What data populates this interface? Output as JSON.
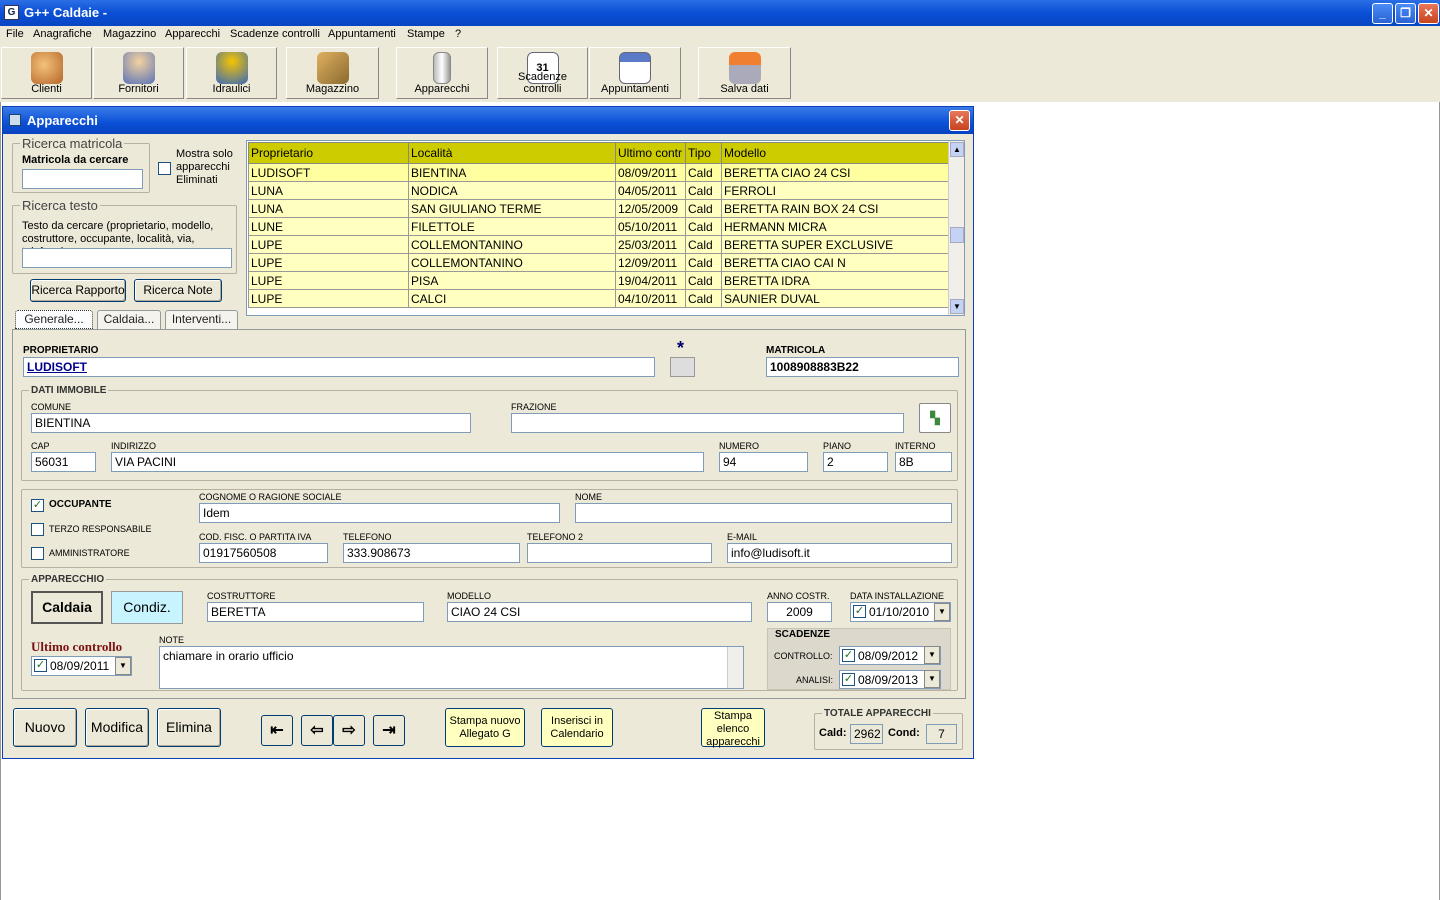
{
  "app": {
    "title": "G++ Caldaie -"
  },
  "menu": [
    "File",
    "Anagrafiche",
    "Magazzino",
    "Apparecchi",
    "Scadenze controlli",
    "Appuntamenti",
    "Stampe",
    "?"
  ],
  "toolbar": [
    "Clienti",
    "Fornitori",
    "Idraulici",
    "Magazzino",
    "Apparecchi",
    "Scadenze controlli",
    "Appuntamenti",
    "Salva dati"
  ],
  "window": {
    "title": "Apparecchi"
  },
  "search": {
    "matricola_legend": "Ricerca matricola",
    "matricola_label": "Matricola da cercare",
    "matricola_value": "",
    "show_deleted": "Mostra solo apparecchi Eliminati",
    "text_legend": "Ricerca testo",
    "text_label": "Testo da cercare (proprietario, modello, costruttore, occupante, località, via, telefono)",
    "text_value": "",
    "btn_rapporto": "Ricerca Rapporto",
    "btn_note": "Ricerca Note"
  },
  "grid": {
    "columns": [
      "Proprietario",
      "Località",
      "Ultimo contr",
      "Tipo",
      "Modello"
    ],
    "rows": [
      [
        "LUDISOFT",
        "BIENTINA",
        "08/09/2011",
        "Cald",
        "BERETTA CIAO 24 CSI"
      ],
      [
        "LUNA",
        "NODICA",
        "04/05/2011",
        "Cald",
        "FERROLI"
      ],
      [
        "LUNA",
        "SAN GIULIANO TERME",
        "12/05/2009",
        "Cald",
        "BERETTA RAIN BOX 24 CSI"
      ],
      [
        "LUNE",
        "FILETTOLE",
        "05/10/2011",
        "Cald",
        "HERMANN MICRA"
      ],
      [
        "LUPE",
        "COLLEMONTANINO",
        "25/03/2011",
        "Cald",
        "BERETTA SUPER EXCLUSIVE"
      ],
      [
        "LUPE",
        "COLLEMONTANINO",
        "12/09/2011",
        "Cald",
        "BERETTA CIAO CAI N"
      ],
      [
        "LUPE",
        "PISA",
        "19/04/2011",
        "Cald",
        "BERETTA IDRA"
      ],
      [
        "LUPE",
        "CALCI",
        "04/10/2011",
        "Cald",
        "SAUNIER DUVAL"
      ]
    ]
  },
  "tabs": [
    "Generale...",
    "Caldaia...",
    "Interventi..."
  ],
  "form": {
    "proprietario_label": "PROPRIETARIO",
    "proprietario": "LUDISOFT",
    "asterisk": "*",
    "matricola_label": "MATRICOLA",
    "matricola": "1008908883B22",
    "immobile_legend": "DATI IMMOBILE",
    "comune_label": "COMUNE",
    "comune": "BIENTINA",
    "frazione_label": "FRAZIONE",
    "frazione": "",
    "cap_label": "CAP",
    "cap": "56031",
    "indirizzo_label": "INDIRIZZO",
    "indirizzo": "VIA PACINI",
    "numero_label": "NUMERO",
    "numero": "94",
    "piano_label": "PIANO",
    "piano": "2",
    "interno_label": "INTERNO",
    "interno": "8B",
    "occupante": "OCCUPANTE",
    "terzo": "TERZO RESPONSABILE",
    "amministratore": "AMMINISTRATORE",
    "cognome_label": "COGNOME O RAGIONE SOCIALE",
    "cognome": "Idem",
    "nome_label": "NOME",
    "nome": "",
    "codfisc_label": "COD. FISC. O PARTITA IVA",
    "codfisc": "01917560508",
    "tel_label": "TELEFONO",
    "tel": "333.908673",
    "tel2_label": "TELEFONO 2",
    "tel2": "",
    "email_label": "E-MAIL",
    "email": "info@ludisoft.it",
    "apparecchio_legend": "APPARECCHIO",
    "caldaia_btn": "Caldaia",
    "condiz_btn": "Condiz.",
    "costruttore_label": "COSTRUTTORE",
    "costruttore": "BERETTA",
    "modello_label": "MODELLO",
    "modello": "CIAO 24 CSI",
    "anno_label": "ANNO COSTR.",
    "anno": "2009",
    "datainst_label": "DATA INSTALLAZIONE",
    "datainst": "01/10/2010",
    "ultimo_label": "Ultimo controllo",
    "ultimo": "08/09/2011",
    "note_label": "NOTE",
    "note": "chiamare in orario ufficio",
    "scadenze_legend": "SCADENZE",
    "controllo_label": "CONTROLLO:",
    "controllo": "08/09/2012",
    "analisi_label": "ANALISI:",
    "analisi": "08/09/2013"
  },
  "bottom": {
    "nuovo": "Nuovo",
    "modifica": "Modifica",
    "elimina": "Elimina",
    "stampa_allegato": "Stampa nuovo Allegato G",
    "inserisci_cal": "Inserisci in Calendario",
    "stampa_elenco": "Stampa elenco apparecchi",
    "totale_legend": "TOTALE APPARECCHI",
    "cald_label": "Cald:",
    "cald": "2962",
    "cond_label": "Cond:",
    "cond": "7"
  },
  "colors": {
    "title_blue": "#0a4fd6",
    "grid_header": "#cccc00",
    "grid_row": "#ffffc0",
    "condiz": "#c8f4ff"
  }
}
